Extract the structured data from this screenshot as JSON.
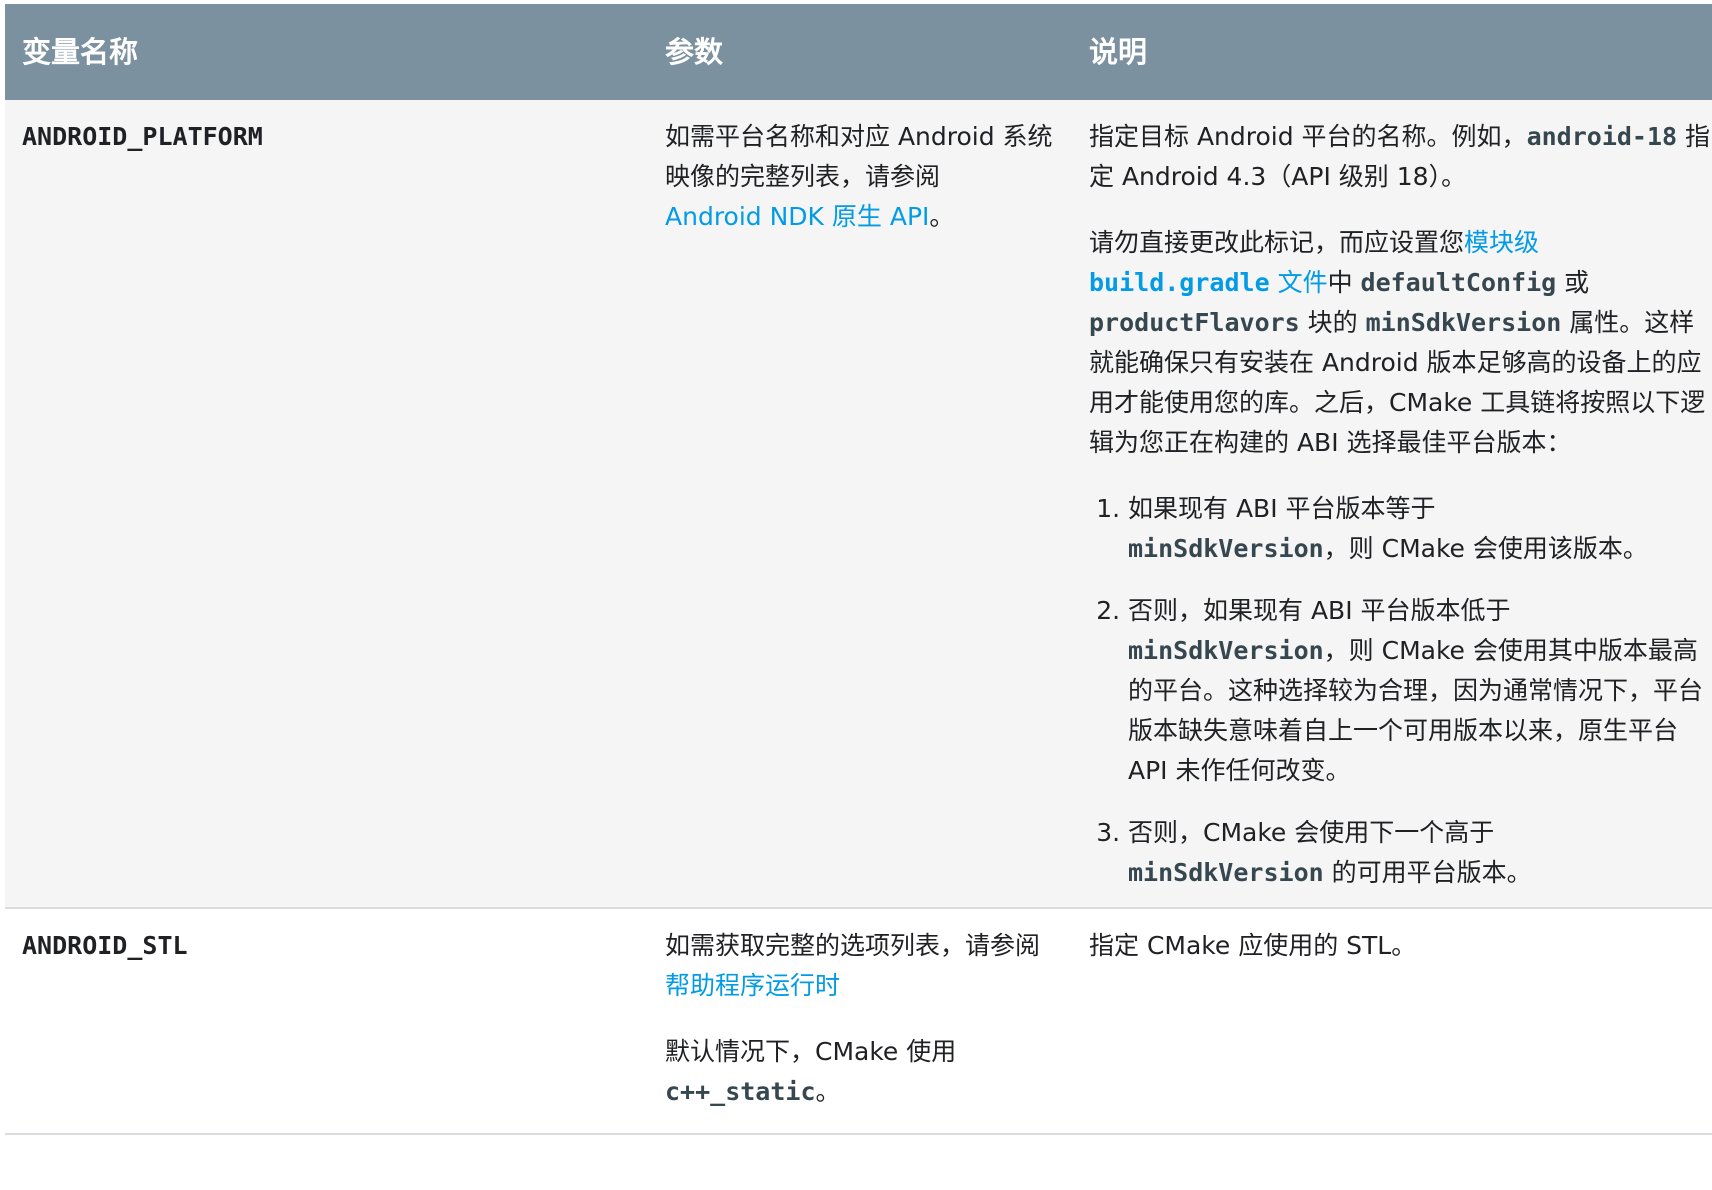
{
  "table": {
    "headers": {
      "name": "变量名称",
      "params": "参数",
      "desc": "说明"
    },
    "row1": {
      "name": "ANDROID_PLATFORM",
      "param": {
        "text1": "如需平台名称和对应 Android 系统映像的完整列表，请参阅",
        "link": "Android NDK 原生 API",
        "text2": "。"
      },
      "desc": {
        "p1": {
          "t1": "指定目标 Android 平台的名称。例如，",
          "code1": "android-18",
          "t2": " 指定 Android 4.3（API 级别 18）。"
        },
        "p2": {
          "t1": "请勿直接更改此标记，而应设置您",
          "link1": "模块级",
          "code_link": "build.gradle",
          "link2": " 文件",
          "t2": "中 ",
          "code1": "defaultConfig",
          "t3": " 或 ",
          "code2": "productFlavors",
          "t4": " 块的 ",
          "code3": "minSdkVersion",
          "t5": " 属性。这样就能确保只有安装在 Android 版本足够高的设备上的应用才能使用您的库。之后，CMake 工具链将按照以下逻辑为您正在构建的 ABI 选择最佳平台版本："
        },
        "list": [
          {
            "t1": "如果现有 ABI 平台版本等于 ",
            "code": "minSdkVersion",
            "t2": "，则 CMake 会使用该版本。"
          },
          {
            "t1": "否则，如果现有 ABI 平台版本低于 ",
            "code": "minSdkVersion",
            "t2": "，则 CMake 会使用其中版本最高的平台。这种选择较为合理，因为通常情况下，平台版本缺失意味着自上一个可用版本以来，原生平台 API 未作任何改变。"
          },
          {
            "t1": "否则，CMake 会使用下一个高于 ",
            "code": "minSdkVersion",
            "t2": " 的可用平台版本。"
          }
        ]
      }
    },
    "row2": {
      "name": "ANDROID_STL",
      "param": {
        "p1": {
          "t1": "如需获取完整的选项列表，请参阅",
          "link": "帮助程序运行时"
        },
        "p2": {
          "t1": "默认情况下，CMake 使用 ",
          "code": "c++_static",
          "t2": "。"
        }
      },
      "desc": "指定 CMake 应使用的 STL。"
    }
  },
  "colors": {
    "header_bg": "#7b919f",
    "link": "#039be5",
    "row_alt_bg": "#f5f5f5"
  }
}
